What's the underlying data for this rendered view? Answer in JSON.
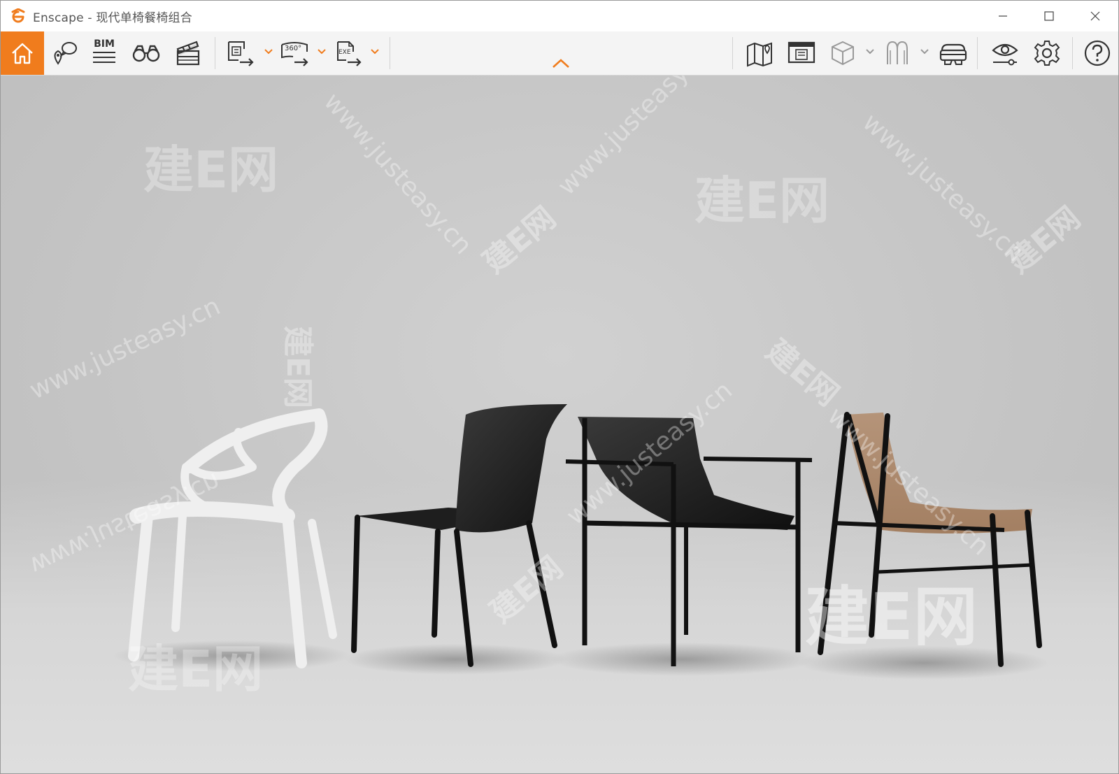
{
  "window": {
    "app_name": "Enscape",
    "separator": " - ",
    "document_title": "现代单椅餐椅组合"
  },
  "toolbar": {
    "bim_label": "BIM",
    "panorama_label": "360°",
    "exe_label": "EXE"
  },
  "watermarks": {
    "brand": "建E网",
    "url": "www.justeasy.cn"
  },
  "colors": {
    "accent": "#f07c1d",
    "toolbar_bg": "#f4f4f4",
    "viewport_bg": "#c8c8c8"
  },
  "icons": [
    "enscape-logo-icon",
    "home-icon",
    "map-pin-icon",
    "bim-icon",
    "binoculars-icon",
    "clapper-icon",
    "screenshot-export-icon",
    "panorama-export-icon",
    "exe-export-icon",
    "chevron-down-icon",
    "chevron-up-icon",
    "map-icon",
    "view-management-icon",
    "cube-icon",
    "asset-library-icon",
    "vr-headset-icon",
    "visual-settings-icon",
    "settings-gear-icon",
    "help-icon",
    "minimize-icon",
    "maximize-icon",
    "close-icon"
  ]
}
